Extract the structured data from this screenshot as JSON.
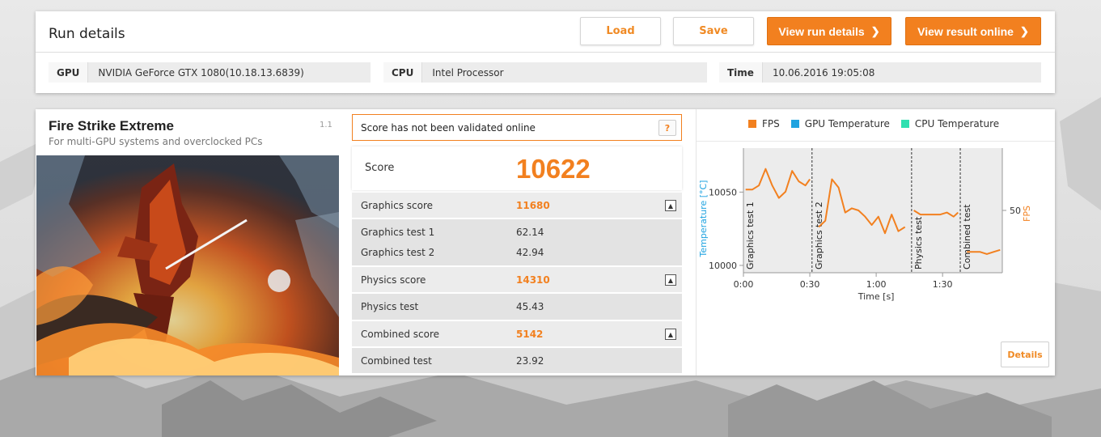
{
  "run": {
    "title": "Run details",
    "load_label": "Load",
    "save_label": "Save",
    "view_run_label": "View run details",
    "view_online_label": "View result online",
    "gpu_label": "GPU",
    "gpu_value": "NVIDIA GeForce GTX 1080(10.18.13.6839)",
    "cpu_label": "CPU",
    "cpu_value": "Intel Processor",
    "time_label": "Time",
    "time_value": "10.06.2016 19:05:08"
  },
  "benchmark": {
    "title": "Fire Strike Extreme",
    "subtitle": "For multi-GPU systems and overclocked PCs",
    "version": "1.1"
  },
  "validation": {
    "text": "Score has not been validated online",
    "help": "?"
  },
  "score": {
    "label": "Score",
    "value": "10622"
  },
  "results": {
    "graphics": {
      "label": "Graphics score",
      "value": "11680",
      "tests": [
        {
          "label": "Graphics test 1",
          "value": "62.14"
        },
        {
          "label": "Graphics test 2",
          "value": "42.94"
        }
      ]
    },
    "physics": {
      "label": "Physics score",
      "value": "14310",
      "tests": [
        {
          "label": "Physics test",
          "value": "45.43"
        }
      ]
    },
    "combined": {
      "label": "Combined score",
      "value": "5142",
      "tests": [
        {
          "label": "Combined test",
          "value": "23.92"
        }
      ]
    }
  },
  "monitor": {
    "details_label": "Details",
    "legend": [
      {
        "name": "FPS",
        "color": "#f2801f"
      },
      {
        "name": "GPU Temperature",
        "color": "#1fa3e0"
      },
      {
        "name": "CPU Temperature",
        "color": "#2fe0b0"
      }
    ]
  },
  "chart_data": {
    "type": "line",
    "xlabel": "Time [s]",
    "ylabel": "Temperature [°C]",
    "y2label": "FPS",
    "x_ticks": [
      "0:00",
      "0:30",
      "1:00",
      "1:30"
    ],
    "y_ticks": [
      "10050",
      "10000"
    ],
    "y2_ticks": [
      "50"
    ],
    "xlim": [
      0,
      117
    ],
    "ylim": [
      9995,
      10080
    ],
    "y2lim": [
      20,
      80
    ],
    "segments": [
      {
        "name": "Graphics test 1",
        "start": 0
      },
      {
        "name": "Graphics test 2",
        "start": 31
      },
      {
        "name": "Physics test",
        "start": 76
      },
      {
        "name": "Combined test",
        "start": 98
      }
    ],
    "series": [
      {
        "name": "FPS",
        "color": "#f2801f",
        "x": [
          1,
          4,
          7,
          10,
          13,
          16,
          19,
          22,
          25,
          28,
          30,
          34,
          37,
          40,
          43,
          46,
          49,
          52,
          55,
          58,
          61,
          64,
          67,
          70,
          73,
          77,
          80,
          83,
          86,
          89,
          92,
          95,
          97,
          101,
          104,
          107,
          110,
          113,
          116
        ],
        "y": [
          60,
          60,
          62,
          70,
          62,
          56,
          59,
          69,
          64,
          62,
          65,
          42,
          45,
          65,
          61,
          49,
          51,
          50,
          47,
          43,
          47,
          39,
          48,
          40,
          42,
          50,
          48,
          48,
          48,
          48,
          49,
          47,
          49,
          30,
          30,
          30,
          29,
          30,
          31
        ]
      }
    ]
  }
}
